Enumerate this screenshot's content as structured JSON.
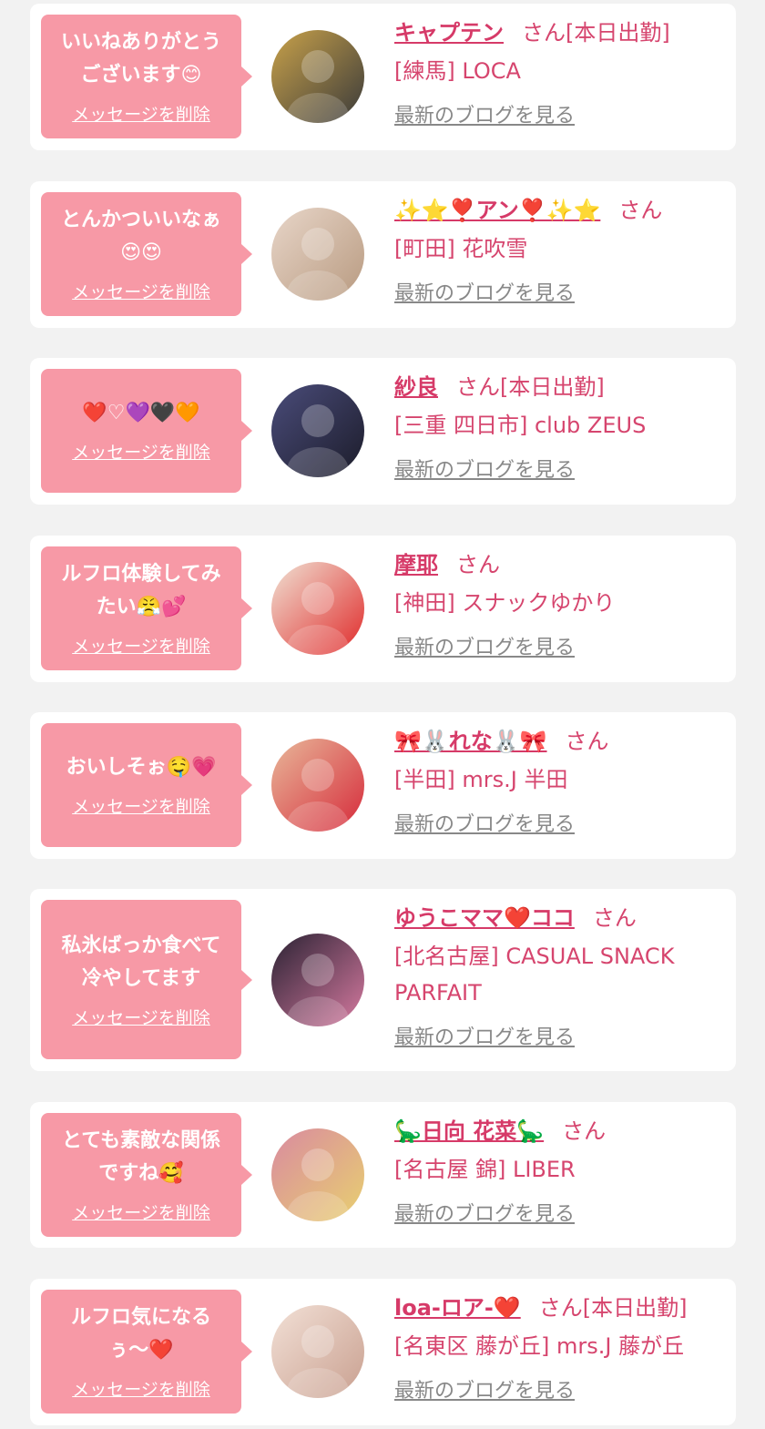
{
  "ui": {
    "delete_label": "メッセージを削除",
    "blog_label": "最新のブログを見る",
    "honorific": "さん"
  },
  "likes": [
    {
      "message": "いいねありがとう\nございます😊",
      "name": "キャプテン",
      "status": "[本日出勤]",
      "shop": "[練馬] LOCA",
      "avatar_colors": [
        "#c9a24a",
        "#3a3a3a"
      ]
    },
    {
      "message": "とんかついいなぁ\n😍😍",
      "name": "✨⭐❣️アン❣️✨⭐",
      "status": "",
      "shop": "[町田] 花吹雪",
      "avatar_colors": [
        "#e8d6c9",
        "#b89a80"
      ]
    },
    {
      "message": "❤️♡💜🖤🧡",
      "name": "紗良",
      "status": "[本日出勤]",
      "shop": "[三重 四日市] club ZEUS",
      "avatar_colors": [
        "#4a4c7a",
        "#1c1c2a"
      ]
    },
    {
      "message": "ルフロ体験してみ\nたい😤💕",
      "name": "摩耶",
      "status": "",
      "shop": "[神田] スナックゆかり",
      "avatar_colors": [
        "#f0e2d4",
        "#e02a2a"
      ]
    },
    {
      "message": "おいしそぉ🤤💗",
      "name": "🎀🐰れな🐰🎀",
      "status": "",
      "shop": "[半田] mrs.J 半田",
      "avatar_colors": [
        "#e8b89a",
        "#d62a3a"
      ]
    },
    {
      "message": "私氷ばっか食べて\n冷やしてます",
      "name": "ゆうこママ❤️ココ",
      "status": "",
      "shop": "[北名古屋] CASUAL SNACK PARFAIT",
      "avatar_colors": [
        "#2a2233",
        "#d67aa0"
      ]
    },
    {
      "message": "とても素敵な関係\nですね🥰",
      "name": "🦕日向 花菜🦕",
      "status": "",
      "shop": "[名古屋 錦] LIBER",
      "avatar_colors": [
        "#d98aa0",
        "#e8d070"
      ]
    },
    {
      "message": "ルフロ気になる\nぅ〜❤️",
      "name": "loa-ロア-❤️",
      "status": "[本日出勤]",
      "shop": "[名東区 藤が丘] mrs.J 藤が丘",
      "avatar_colors": [
        "#f2e0d6",
        "#c9a090"
      ]
    }
  ]
}
